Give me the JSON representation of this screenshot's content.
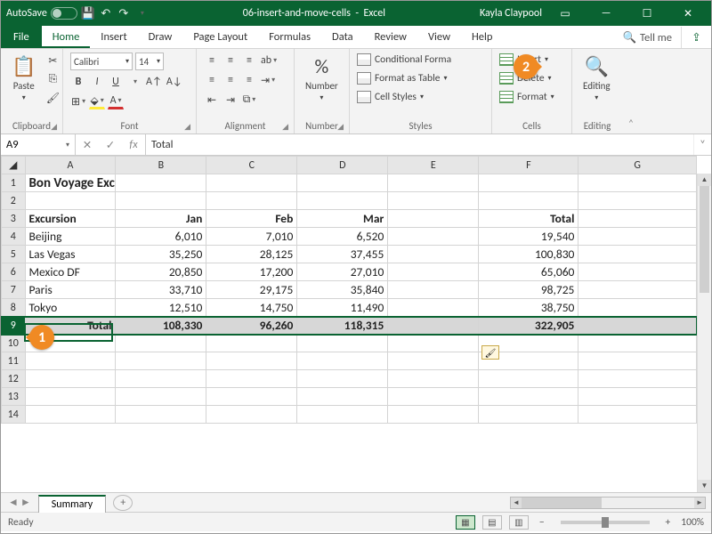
{
  "titlebar": {
    "autosave_label": "AutoSave",
    "doc_name": "06-insert-and-move-cells",
    "app_name": "Excel",
    "user": "Kayla Claypool"
  },
  "tabs": {
    "file": "File",
    "items": [
      "Home",
      "Insert",
      "Draw",
      "Page Layout",
      "Formulas",
      "Data",
      "Review",
      "View",
      "Help"
    ],
    "active": "Home",
    "tellme": "Tell me"
  },
  "ribbon": {
    "clipboard": {
      "label": "Clipboard",
      "paste": "Paste"
    },
    "font": {
      "label": "Font",
      "name": "Calibri",
      "size": "14"
    },
    "alignment": {
      "label": "Alignment"
    },
    "number": {
      "label": "Number",
      "btn": "Number"
    },
    "styles": {
      "label": "Styles",
      "conditional": "Conditional Forma",
      "table": "Format as Table",
      "cell": "Cell Styles"
    },
    "cells": {
      "label": "Cells",
      "insert": "Insert",
      "delete": "Delete",
      "format": "Format"
    },
    "editing": {
      "label": "Editing",
      "btn": "Editing"
    }
  },
  "name_box": "A9",
  "formula": "Total",
  "columns": [
    "A",
    "B",
    "C",
    "D",
    "E",
    "F",
    "G"
  ],
  "sheet": {
    "title": "Bon Voyage Excursions",
    "header": {
      "a": "Excursion",
      "b": "Jan",
      "c": "Feb",
      "d": "Mar",
      "f": "Total"
    },
    "rows": [
      {
        "a": "Beijing",
        "b": "6,010",
        "c": "7,010",
        "d": "6,520",
        "f": "19,540"
      },
      {
        "a": "Las Vegas",
        "b": "35,250",
        "c": "28,125",
        "d": "37,455",
        "f": "100,830"
      },
      {
        "a": "Mexico DF",
        "b": "20,850",
        "c": "17,200",
        "d": "27,010",
        "f": "65,060"
      },
      {
        "a": "Paris",
        "b": "33,710",
        "c": "29,175",
        "d": "35,840",
        "f": "98,725"
      },
      {
        "a": "Tokyo",
        "b": "12,510",
        "c": "14,750",
        "d": "11,490",
        "f": "38,750"
      }
    ],
    "total_row": {
      "a": "Total",
      "b": "108,330",
      "c": "96,260",
      "d": "118,315",
      "f": "322,905"
    }
  },
  "sheet_tab": "Summary",
  "status": {
    "ready": "Ready",
    "zoom": "100%"
  },
  "callouts": {
    "one": "1",
    "two": "2"
  }
}
